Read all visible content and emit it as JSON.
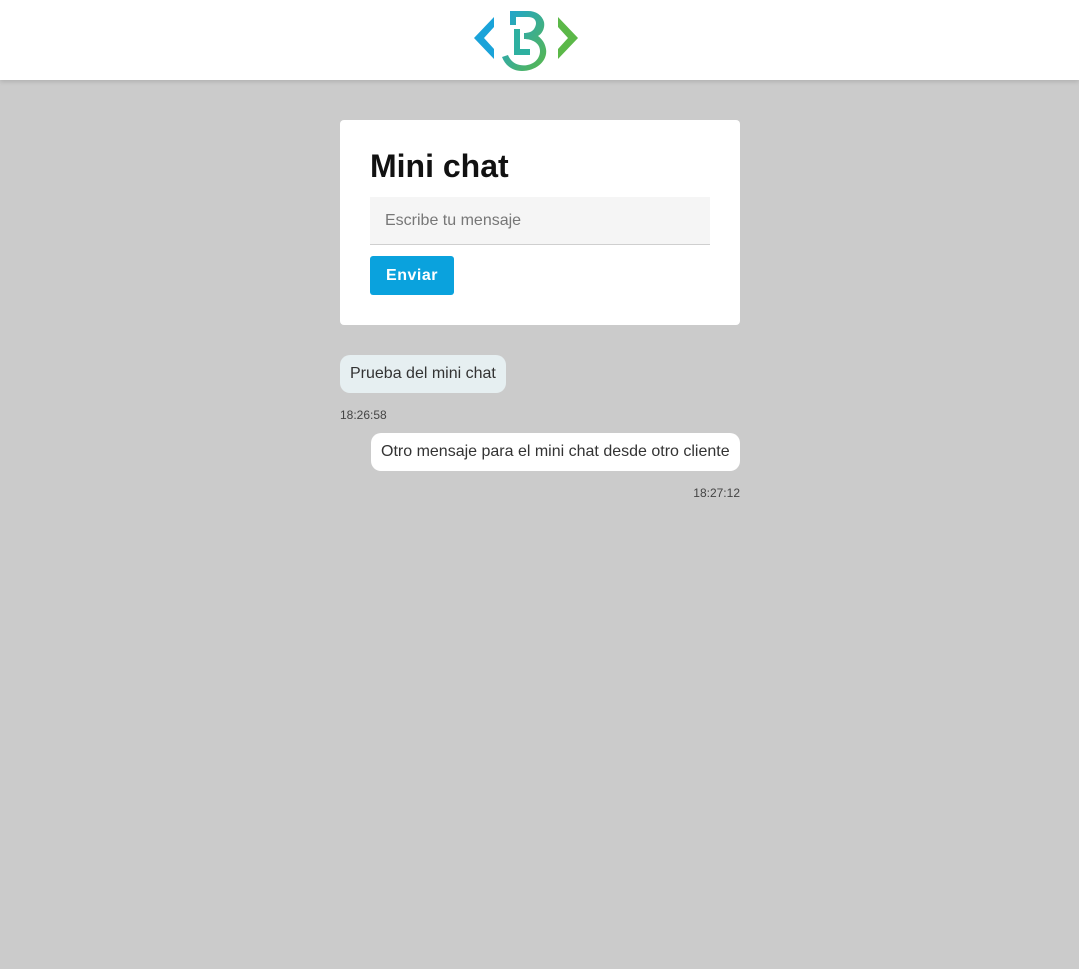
{
  "header": {
    "logo_icon": "brand-b-logo-icon",
    "logo_colors": [
      "#1aa3d9",
      "#5bb848"
    ]
  },
  "chat_form": {
    "title": "Mini chat",
    "input_placeholder": "Escribe tu mensaje",
    "input_value": "",
    "send_label": "Enviar",
    "send_color": "#0aa2dd"
  },
  "messages": [
    {
      "text": "Prueba del mini chat",
      "time": "18:26:58",
      "align": "left"
    },
    {
      "text": "Otro mensaje para el mini chat desde otro cliente",
      "time": "18:27:12",
      "align": "right"
    }
  ]
}
